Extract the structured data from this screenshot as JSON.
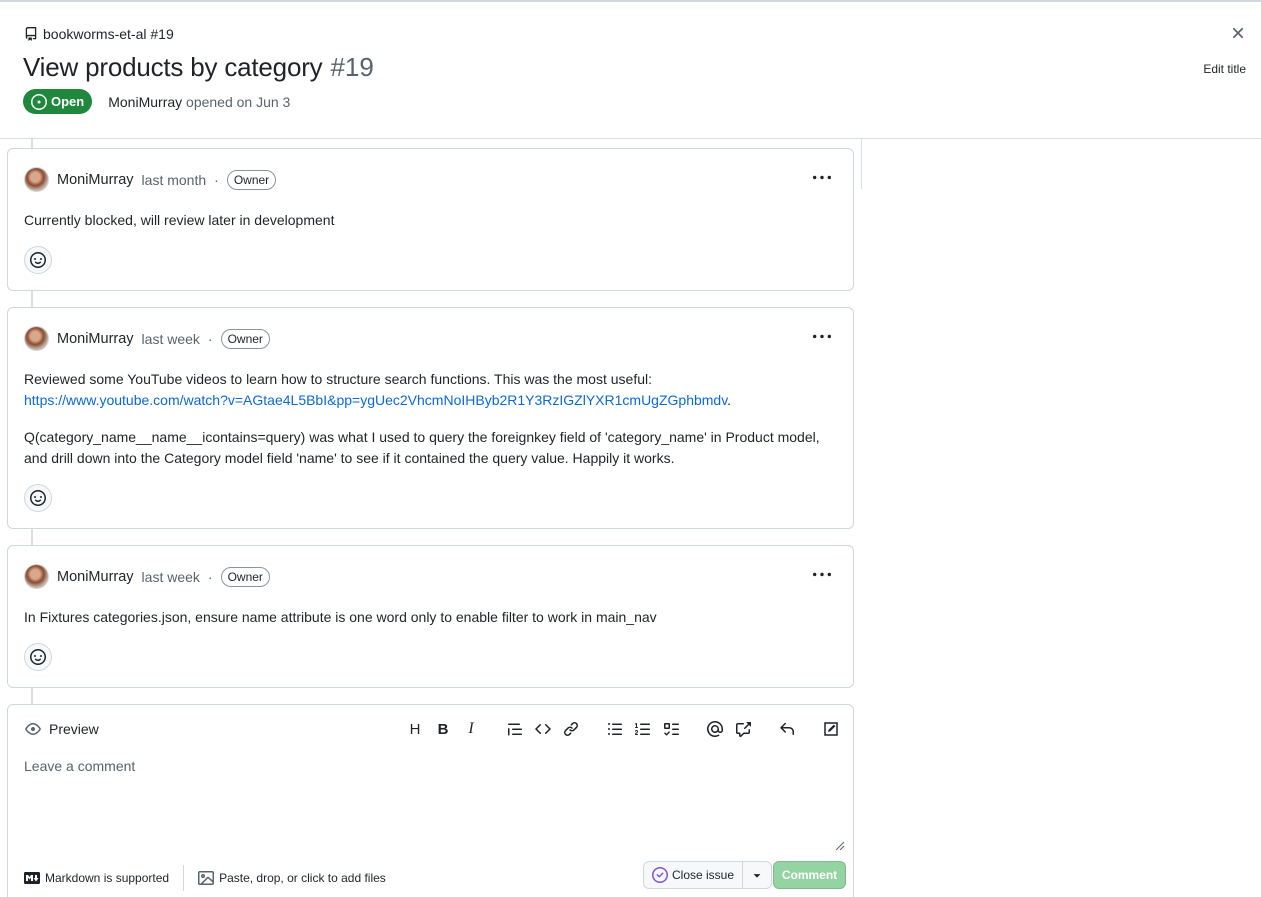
{
  "header": {
    "repo_ref": "bookworms-et-al #19",
    "title": "View products by category",
    "number": "#19",
    "state_label": "Open",
    "author": "MoniMurray",
    "opened_text": "opened on Jun 3",
    "edit_title_label": "Edit title"
  },
  "comments": [
    {
      "author": "MoniMurray",
      "when": "last month",
      "sep": "·",
      "role": "Owner",
      "paragraphs": [
        "Currently blocked, will review later in development"
      ]
    },
    {
      "author": "MoniMurray",
      "when": "last week",
      "sep": "·",
      "role": "Owner",
      "p1_text": "Reviewed some YouTube videos to learn how to structure search functions. This was the most useful:",
      "p1_link": "https://www.youtube.com/watch?v=AGtae4L5BbI&pp=ygUec2VhcmNoIHByb2R1Y3RzIGZlYXR1cmUgZGphbmdv",
      "p1_end": ".",
      "p2_text": "Q(category_name__name__icontains=query) was what I used to query the foreignkey field of 'category_name' in Product model, and drill down into the Category model field 'name' to see if it contained the query value. Happily it works."
    },
    {
      "author": "MoniMurray",
      "when": "last week",
      "sep": "·",
      "role": "Owner",
      "paragraphs": [
        "In Fixtures categories.json, ensure name attribute is one word only to enable filter to work in main_nav"
      ]
    }
  ],
  "composer": {
    "preview_label": "Preview",
    "placeholder": "Leave a comment",
    "toolbar": {
      "heading": "H",
      "bold": "B",
      "italic": "I"
    },
    "markdown_note": "Markdown is supported",
    "files_note": "Paste, drop, or click to add files",
    "close_issue_label": "Close issue",
    "comment_label": "Comment"
  },
  "colors": {
    "open_green": "#1f883d",
    "link_blue": "#0969da",
    "comment_disabled": "#94d3a2"
  }
}
